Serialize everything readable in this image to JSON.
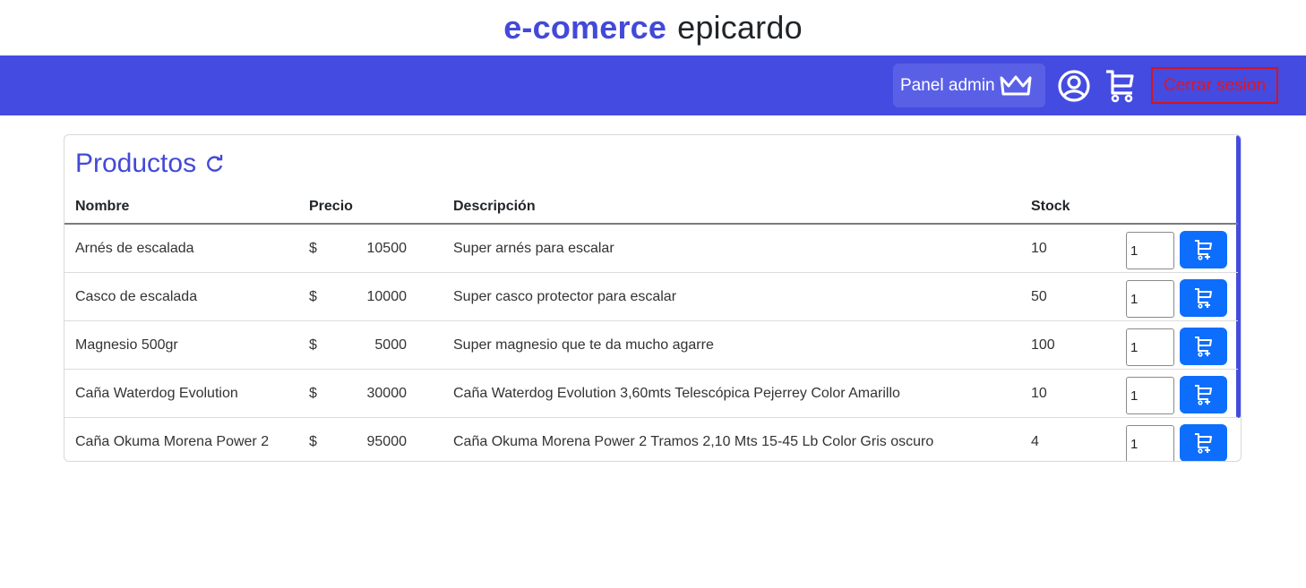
{
  "header": {
    "brand_strong": "e-comerce",
    "brand_rest": "epicardo"
  },
  "nav": {
    "admin_label": "Panel admin",
    "logout_label": "Cerrar sesion",
    "icons": [
      "crown-icon",
      "user-circle-icon",
      "cart-icon"
    ],
    "colors": {
      "navbar": "#444be0",
      "logout": "#e4141f"
    }
  },
  "products": {
    "title": "Productos",
    "columns": {
      "name": "Nombre",
      "price": "Precio",
      "description": "Descripción",
      "stock": "Stock"
    },
    "currency": "$",
    "rows": [
      {
        "name": "Arnés de escalada",
        "price": "10500",
        "description": "Super arnés para escalar",
        "stock": "10",
        "qty": "1"
      },
      {
        "name": "Casco de escalada",
        "price": "10000",
        "description": "Super casco protector para escalar",
        "stock": "50",
        "qty": "1"
      },
      {
        "name": "Magnesio 500gr",
        "price": "5000",
        "description": "Super magnesio que te da mucho agarre",
        "stock": "100",
        "qty": "1"
      },
      {
        "name": "Caña Waterdog Evolution",
        "price": "30000",
        "description": "Caña Waterdog Evolution 3,60mts Telescópica Pejerrey Color Amarillo",
        "stock": "10",
        "qty": "1"
      },
      {
        "name": "Caña Okuma Morena Power 2",
        "price": "95000",
        "description": "Caña Okuma Morena Power 2 Tramos 2,10 Mts 15-45 Lb Color Gris oscuro",
        "stock": "4",
        "qty": "1"
      }
    ]
  }
}
